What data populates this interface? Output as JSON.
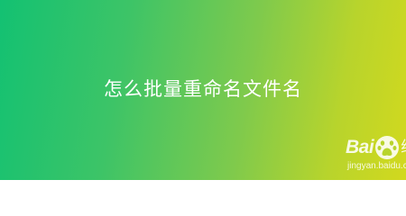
{
  "banner": {
    "title": "怎么批量重命名文件名"
  },
  "watermark": {
    "brand_text": "Bai",
    "paw_icon": "baidu-paw-icon",
    "jingyan_char": "经",
    "url": "jingyan.baidu.com"
  },
  "colors": {
    "gradient_start": "#13c172",
    "gradient_end": "#d2d91e",
    "text": "#ffffff"
  }
}
